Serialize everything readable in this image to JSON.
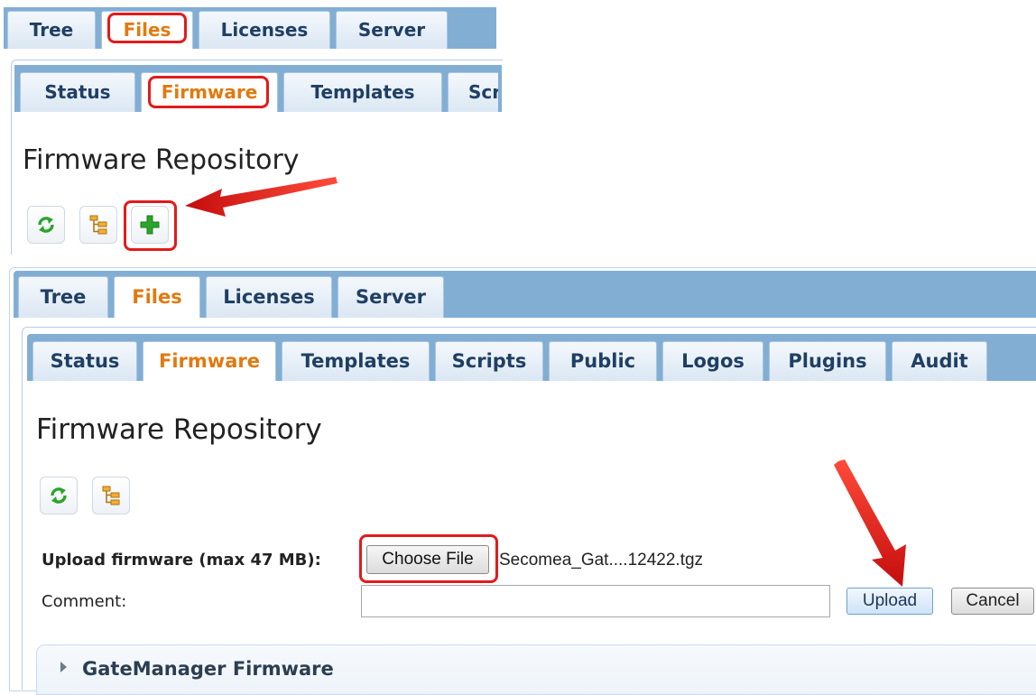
{
  "top_snippet": {
    "main_tabs": [
      "Tree",
      "Files",
      "Licenses",
      "Server"
    ],
    "active_main_tab": "Files",
    "sub_tabs": [
      "Status",
      "Firmware",
      "Templates",
      "Scr"
    ],
    "active_sub_tab": "Firmware",
    "heading": "Firmware Repository",
    "icons": [
      "refresh-icon",
      "tree-icon",
      "add-icon"
    ]
  },
  "bottom_snippet": {
    "main_tabs": [
      "Tree",
      "Files",
      "Licenses",
      "Server"
    ],
    "active_main_tab": "Files",
    "sub_tabs": [
      "Status",
      "Firmware",
      "Templates",
      "Scripts",
      "Public",
      "Logos",
      "Plugins",
      "Audit"
    ],
    "active_sub_tab": "Firmware",
    "heading": "Firmware Repository",
    "icons": [
      "refresh-icon",
      "tree-icon"
    ],
    "upload": {
      "label": "Upload firmware (max 47 MB):",
      "choose_file_label": "Choose File",
      "selected_file": "Secomea_Gat....12422.tgz",
      "comment_label": "Comment:",
      "comment_value": "",
      "upload_label": "Upload",
      "cancel_label": "Cancel"
    },
    "section_title": "GateManager Firmware"
  },
  "colors": {
    "tab_bar": "#82aed4",
    "active_tab_text": "#e07a10",
    "tab_text": "#1f3f63",
    "annotation_red": "#e21b1b"
  }
}
